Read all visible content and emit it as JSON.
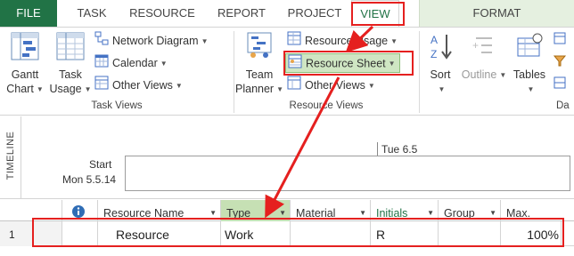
{
  "tabs": [
    "FILE",
    "TASK",
    "RESOURCE",
    "REPORT",
    "PROJECT",
    "VIEW",
    "FORMAT"
  ],
  "ribbon": {
    "task_views": {
      "label": "Task Views",
      "gantt_line1": "Gantt",
      "gantt_line2": "Chart",
      "usage_line1": "Task",
      "usage_line2": "Usage",
      "network_diagram": "Network Diagram",
      "calendar": "Calendar",
      "other_views": "Other Views"
    },
    "resource_views": {
      "label": "Resource Views",
      "team_line1": "Team",
      "team_line2": "Planner",
      "resource_usage": "Resource Usage",
      "resource_sheet": "Resource Sheet",
      "other_views": "Other Views"
    },
    "data": {
      "label": "Da",
      "sort": "Sort",
      "outline": "Outline",
      "tables": "Tables"
    }
  },
  "timeline": {
    "label": "TIMELINE",
    "start_label": "Start",
    "start_date": "Mon 5.5.14",
    "tick_date": "Tue 6.5"
  },
  "grid": {
    "columns": [
      "Resource Name",
      "Type",
      "Material",
      "Initials",
      "Group",
      "Max."
    ],
    "rows": [
      {
        "id": "1",
        "name": "Resource",
        "type": "Work",
        "material": "",
        "initials": "R",
        "group": "",
        "max": "100%"
      }
    ]
  },
  "colors": {
    "accent_green": "#217346",
    "annotation_red": "#e5201f",
    "format_tab_bg": "#e5f0e0",
    "selected_header_bg": "#c6e0b4"
  }
}
